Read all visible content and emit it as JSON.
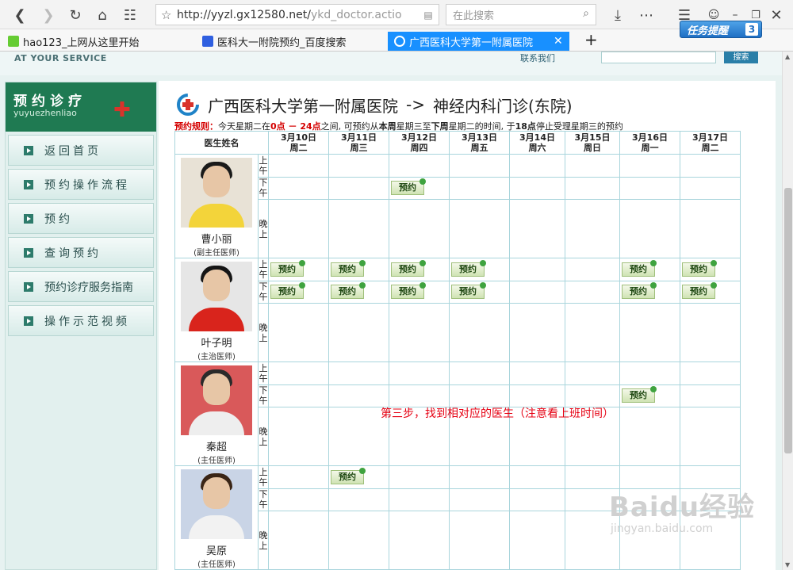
{
  "browser": {
    "url_main": "http://yyzl.gx12580.net/",
    "url_rest": "ykd_doctor.actio",
    "search_placeholder": "在此搜索",
    "tabs": [
      {
        "label": "hao123_上网从这里开始"
      },
      {
        "label": "医科大一附院预约_百度搜索"
      },
      {
        "label": "广西医科大学第一附属医院"
      }
    ],
    "task_label": "任务提醒",
    "task_count": "3"
  },
  "site": {
    "service": "AT YOUR SERVICE",
    "contact": "联系我们",
    "search_btn": "搜索"
  },
  "sidebar": {
    "title": "预约诊疗",
    "subtitle": "yuyuezhenliao",
    "items": [
      {
        "label": "返回首页"
      },
      {
        "label": "预约操作流程"
      },
      {
        "label": "预约"
      },
      {
        "label": "查询预约"
      },
      {
        "label": "预约诊疗服务指南"
      },
      {
        "label": "操作示范视频"
      }
    ]
  },
  "main": {
    "hospital": "广西医科大学第一附属医院",
    "arrow": "->",
    "dept": "神经内科门诊(东院)",
    "rule_label": "预约规则：",
    "rule_a": "今天星期二在",
    "rule_b": "0点 － 24点",
    "rule_c": "之间, 可预约从",
    "rule_d": "本周",
    "rule_e": "星期三至",
    "rule_f": "下周",
    "rule_g": "星期二的时间, 于",
    "rule_h": "18点",
    "rule_i": "停止受理星期三的预约",
    "col_doctor": "医生姓名",
    "book_label": "预约",
    "periods": {
      "am": "上午",
      "pm": "下午",
      "eve": "晚上"
    },
    "days": [
      {
        "date": "3月10日",
        "week": "周二"
      },
      {
        "date": "3月11日",
        "week": "周三"
      },
      {
        "date": "3月12日",
        "week": "周四"
      },
      {
        "date": "3月13日",
        "week": "周五"
      },
      {
        "date": "3月14日",
        "week": "周六"
      },
      {
        "date": "3月15日",
        "week": "周日"
      },
      {
        "date": "3月16日",
        "week": "周一"
      },
      {
        "date": "3月17日",
        "week": "周二"
      }
    ],
    "doctors": [
      {
        "name": "曹小丽",
        "title": "(副主任医师)"
      },
      {
        "name": "叶子明",
        "title": "(主治医师)"
      },
      {
        "name": "秦超",
        "title": "(主任医师)"
      },
      {
        "name": "吴原",
        "title": "(主任医师)"
      }
    ],
    "annotation": "第三步，找到相对应的医生（注意看上班时间）"
  },
  "watermark": {
    "line1": "Baidu经验",
    "line2": "jingyan.baidu.com"
  }
}
